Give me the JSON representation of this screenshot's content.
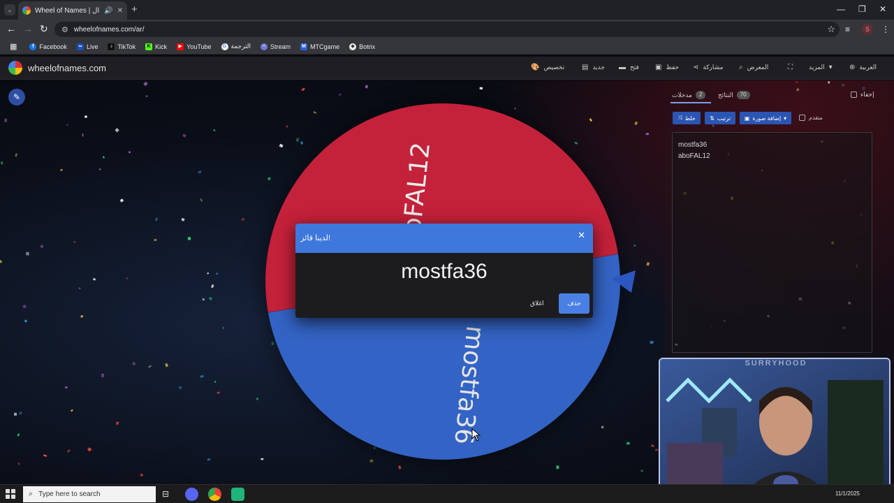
{
  "browser": {
    "tab_title": "Wheel of Names | العشوائي ال",
    "url": "wheelofnames.com/ar/",
    "profile_initial": "S",
    "bookmarks": [
      "Facebook",
      "Live",
      "TikTok",
      "Kick",
      "YouTube",
      "الترجمة",
      "Stream",
      "MTCgame",
      "Botrix"
    ]
  },
  "app": {
    "logo_text": "wheelofnames.com",
    "menu": {
      "customize": "تخصيص",
      "new": "جديد",
      "open": "فتح",
      "save": "حفظ",
      "share": "مشاركة",
      "gallery": "المعرض",
      "more": "المزيد",
      "language": "العربية"
    },
    "panel": {
      "hide_label": "إخفاء",
      "tab_results": "النتائج",
      "results_count": "70",
      "tab_entries": "مدخلات",
      "entries_count": "2",
      "shuffle_label": "خلط",
      "sort_label": "ترتيب",
      "add_image_label": "إضافة صورة",
      "advanced_label": "متقدم",
      "entries": [
        "mostfa36",
        "aboFAL12"
      ]
    },
    "wheel": {
      "segments": [
        {
          "label": "aboFAL12",
          "color": "#c4213a"
        },
        {
          "label": "mostfa36",
          "color": "#3363c4"
        }
      ]
    },
    "dialog": {
      "title": "لدينا فائز!",
      "winner": "mostfa36",
      "remove_label": "حذف",
      "close_label": "اغلاق"
    }
  },
  "webcam": {
    "label": "SURRYHOOD"
  },
  "taskbar": {
    "search_placeholder": "Type here to search",
    "date": "11/1/2025"
  }
}
